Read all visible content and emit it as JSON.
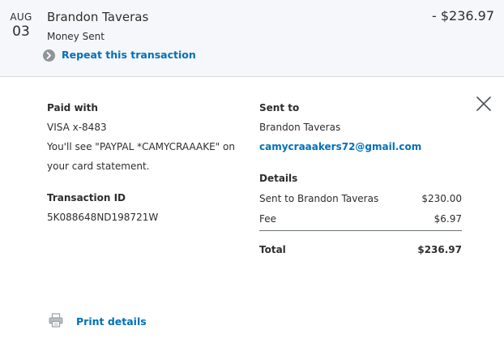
{
  "header": {
    "month": "AUG",
    "day": "03",
    "name": "Brandon Taveras",
    "status": "Money Sent",
    "amount": "- $236.97",
    "repeat_label": "Repeat this transaction"
  },
  "paid_with": {
    "heading": "Paid with",
    "card": "VISA x-8483",
    "statement_line1": "You'll see \"PAYPAL *CAMYCRAAAKE\" on",
    "statement_line2": "your card statement."
  },
  "transaction": {
    "heading": "Transaction ID",
    "id": "5K088648ND198721W"
  },
  "sent_to": {
    "heading": "Sent to",
    "name": "Brandon Taveras",
    "email": "camycraaakers72@gmail.com"
  },
  "details": {
    "heading": "Details",
    "rows": [
      {
        "label": "Sent to Brandon Taveras",
        "value": "$230.00"
      },
      {
        "label": "Fee",
        "value": "$6.97"
      }
    ],
    "total_label": "Total",
    "total_value": "$236.97"
  },
  "print": {
    "label": "Print details"
  },
  "icons": {
    "repeat": "chevron-right-icon",
    "close": "close-icon",
    "print": "printer-icon"
  },
  "colors": {
    "link": "#0070ba",
    "header_bg": "#f5f7fa"
  }
}
